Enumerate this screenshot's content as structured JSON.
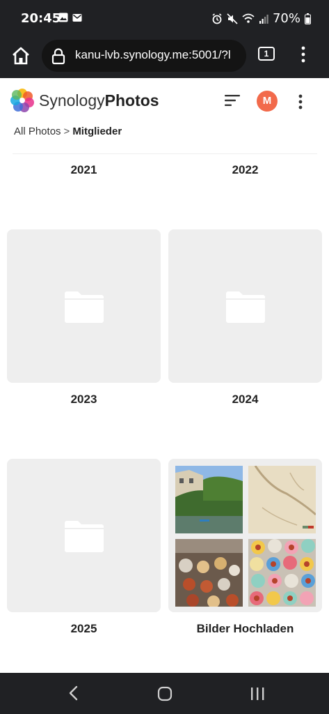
{
  "status_bar": {
    "time": "20:45",
    "battery": "70%",
    "left_icons": [
      "image-icon",
      "mail-icon"
    ],
    "right_icons": [
      "alarm-icon",
      "mute-icon",
      "wifi-icon",
      "signal-icon",
      "battery-icon"
    ]
  },
  "browser": {
    "url": "kanu-lvb.synology.me:5001/?l",
    "tab_count": "1"
  },
  "app": {
    "brand_light": "Synology",
    "brand_bold": "Photos",
    "avatar_initial": "M"
  },
  "breadcrumb": {
    "root": "All Photos",
    "separator": ">",
    "current": "Mitglieder"
  },
  "folders": [
    {
      "label": "2021",
      "type": "folder"
    },
    {
      "label": "2022",
      "type": "folder"
    },
    {
      "label": "2023",
      "type": "folder"
    },
    {
      "label": "2024",
      "type": "folder"
    },
    {
      "label": "2025",
      "type": "folder"
    },
    {
      "label": "Bilder Hochladen",
      "type": "album"
    }
  ],
  "colors": {
    "chrome": "#202124",
    "tile": "#eeeeee",
    "avatar": "#f26a4b",
    "folder": "#ffffff"
  }
}
